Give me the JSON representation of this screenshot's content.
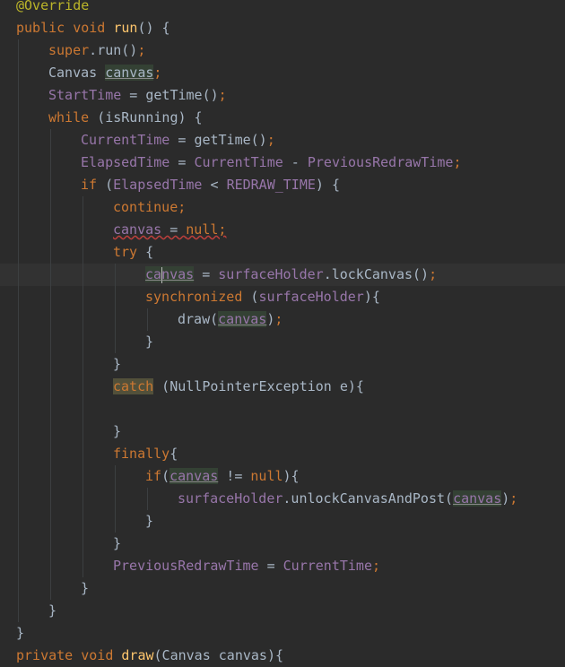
{
  "editor": {
    "theme_colors": {
      "background": "#2b2b2b",
      "current_line": "#323232",
      "keyword": "#cc7832",
      "field": "#9876aa",
      "method": "#ffc66d",
      "annotation": "#bbb529",
      "text": "#a9b7c6"
    },
    "lines": [
      {
        "indent": 0,
        "tokens": [
          {
            "t": "@Override",
            "c": "annotation"
          }
        ]
      },
      {
        "indent": 0,
        "tokens": [
          {
            "t": "public ",
            "c": "keyword"
          },
          {
            "t": "void ",
            "c": "keyword"
          },
          {
            "t": "run",
            "c": "method"
          },
          {
            "t": "() {",
            "c": "punct"
          }
        ]
      },
      {
        "indent": 1,
        "tokens": [
          {
            "t": "super",
            "c": "keyword"
          },
          {
            "t": ".",
            "c": "punct"
          },
          {
            "t": "run",
            "c": "plain"
          },
          {
            "t": "()",
            "c": "punct"
          },
          {
            "t": ";",
            "c": "semicolon"
          }
        ]
      },
      {
        "indent": 1,
        "tokens": [
          {
            "t": "Canvas ",
            "c": "plain"
          },
          {
            "t": "canvas",
            "c": "plain",
            "s": "hl-var"
          },
          {
            "t": ";",
            "c": "semicolon"
          }
        ]
      },
      {
        "indent": 1,
        "tokens": [
          {
            "t": "StartTime",
            "c": "field"
          },
          {
            "t": " = ",
            "c": "punct"
          },
          {
            "t": "getTime",
            "c": "plain"
          },
          {
            "t": "()",
            "c": "punct"
          },
          {
            "t": ";",
            "c": "semicolon"
          }
        ]
      },
      {
        "indent": 1,
        "tokens": [
          {
            "t": "while ",
            "c": "keyword"
          },
          {
            "t": "(isRunning) {",
            "c": "plain"
          }
        ]
      },
      {
        "indent": 2,
        "tokens": [
          {
            "t": "CurrentTime",
            "c": "field"
          },
          {
            "t": " = ",
            "c": "punct"
          },
          {
            "t": "getTime",
            "c": "plain"
          },
          {
            "t": "()",
            "c": "punct"
          },
          {
            "t": ";",
            "c": "semicolon"
          }
        ]
      },
      {
        "indent": 2,
        "tokens": [
          {
            "t": "ElapsedTime",
            "c": "field"
          },
          {
            "t": " = ",
            "c": "punct"
          },
          {
            "t": "CurrentTime",
            "c": "field"
          },
          {
            "t": " - ",
            "c": "punct"
          },
          {
            "t": "PreviousRedrawTime",
            "c": "field"
          },
          {
            "t": ";",
            "c": "semicolon"
          }
        ]
      },
      {
        "indent": 2,
        "tokens": [
          {
            "t": "if ",
            "c": "keyword"
          },
          {
            "t": "(",
            "c": "punct"
          },
          {
            "t": "ElapsedTime",
            "c": "field"
          },
          {
            "t": " < ",
            "c": "punct"
          },
          {
            "t": "REDRAW_TIME",
            "c": "field"
          },
          {
            "t": ") {",
            "c": "punct"
          }
        ]
      },
      {
        "indent": 3,
        "tokens": [
          {
            "t": "continue",
            "c": "keyword"
          },
          {
            "t": ";",
            "c": "semicolon"
          }
        ]
      },
      {
        "indent": 3,
        "tokens": [
          {
            "t": "canvas",
            "c": "field",
            "s": "err-underline"
          },
          {
            "t": " = ",
            "c": "punct",
            "s": "err-underline"
          },
          {
            "t": "null",
            "c": "keyword",
            "s": "err-underline"
          },
          {
            "t": ";",
            "c": "semicolon",
            "s": "err-underline"
          }
        ]
      },
      {
        "indent": 3,
        "tokens": [
          {
            "t": "try ",
            "c": "keyword"
          },
          {
            "t": "{",
            "c": "punct"
          }
        ]
      },
      {
        "indent": 4,
        "current": true,
        "caret_after": 2,
        "tokens": [
          {
            "t": "canvas",
            "c": "field",
            "s": "hl-var"
          },
          {
            "t": " = ",
            "c": "punct"
          },
          {
            "t": "surfaceHolder",
            "c": "field"
          },
          {
            "t": ".lockCanvas()",
            "c": "plain"
          },
          {
            "t": ";",
            "c": "semicolon"
          }
        ]
      },
      {
        "indent": 4,
        "tokens": [
          {
            "t": "synchronized ",
            "c": "keyword"
          },
          {
            "t": "(",
            "c": "punct"
          },
          {
            "t": "surfaceHolder",
            "c": "field"
          },
          {
            "t": "){",
            "c": "punct"
          }
        ]
      },
      {
        "indent": 5,
        "tokens": [
          {
            "t": "draw",
            "c": "plain"
          },
          {
            "t": "(",
            "c": "punct"
          },
          {
            "t": "canvas",
            "c": "field",
            "s": "hl-var"
          },
          {
            "t": ")",
            "c": "punct"
          },
          {
            "t": ";",
            "c": "semicolon"
          }
        ]
      },
      {
        "indent": 4,
        "tokens": [
          {
            "t": "}",
            "c": "punct"
          }
        ]
      },
      {
        "indent": 3,
        "tokens": [
          {
            "t": "}",
            "c": "punct"
          }
        ]
      },
      {
        "indent": 3,
        "tokens": [
          {
            "t": "catch",
            "c": "keyword",
            "s": "warn-bg"
          },
          {
            "t": " (NullPointerException e){",
            "c": "plain"
          }
        ]
      },
      {
        "indent": 3,
        "tokens": []
      },
      {
        "indent": 3,
        "tokens": [
          {
            "t": "}",
            "c": "punct"
          }
        ]
      },
      {
        "indent": 3,
        "tokens": [
          {
            "t": "finally",
            "c": "keyword"
          },
          {
            "t": "{",
            "c": "punct"
          }
        ]
      },
      {
        "indent": 4,
        "tokens": [
          {
            "t": "if",
            "c": "keyword"
          },
          {
            "t": "(",
            "c": "punct"
          },
          {
            "t": "canvas",
            "c": "field",
            "s": "hl-var"
          },
          {
            "t": " != ",
            "c": "punct"
          },
          {
            "t": "null",
            "c": "keyword"
          },
          {
            "t": "){",
            "c": "punct"
          }
        ]
      },
      {
        "indent": 5,
        "tokens": [
          {
            "t": "surfaceHolder",
            "c": "field"
          },
          {
            "t": ".unlockCanvasAndPost(",
            "c": "plain"
          },
          {
            "t": "canvas",
            "c": "field",
            "s": "hl-var"
          },
          {
            "t": ")",
            "c": "punct"
          },
          {
            "t": ";",
            "c": "semicolon"
          }
        ]
      },
      {
        "indent": 4,
        "tokens": [
          {
            "t": "}",
            "c": "punct"
          }
        ]
      },
      {
        "indent": 3,
        "tokens": [
          {
            "t": "}",
            "c": "punct"
          }
        ]
      },
      {
        "indent": 3,
        "tokens": [
          {
            "t": "PreviousRedrawTime",
            "c": "field"
          },
          {
            "t": " = ",
            "c": "punct"
          },
          {
            "t": "CurrentTime",
            "c": "field"
          },
          {
            "t": ";",
            "c": "semicolon"
          }
        ]
      },
      {
        "indent": 2,
        "tokens": [
          {
            "t": "}",
            "c": "punct"
          }
        ]
      },
      {
        "indent": 1,
        "tokens": [
          {
            "t": "}",
            "c": "punct"
          }
        ]
      },
      {
        "indent": 0,
        "tokens": [
          {
            "t": "}",
            "c": "punct"
          }
        ]
      },
      {
        "indent": 0,
        "tokens": [
          {
            "t": "private ",
            "c": "keyword"
          },
          {
            "t": "void ",
            "c": "keyword"
          },
          {
            "t": "draw",
            "c": "method"
          },
          {
            "t": "(Canvas canvas){",
            "c": "plain"
          }
        ]
      }
    ]
  }
}
